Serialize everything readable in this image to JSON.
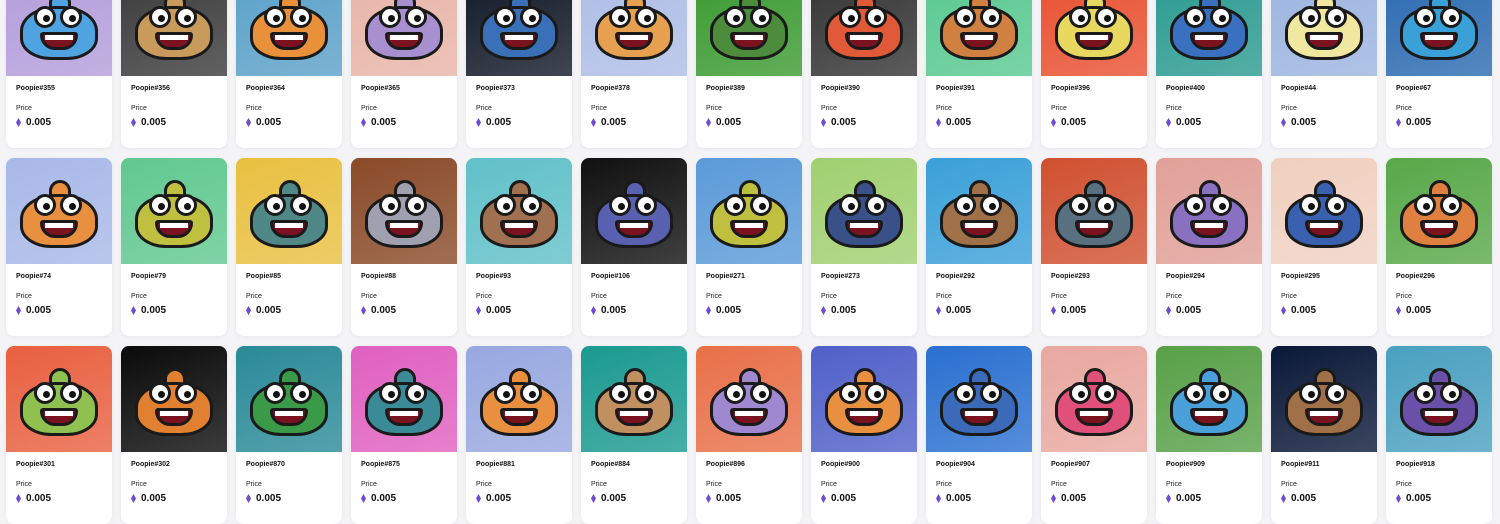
{
  "price_label": "Price",
  "currency_icon": "ethereum-icon",
  "cards": [
    {
      "name": "Poopie#355",
      "price": "0.005",
      "bg": "#b39ddb",
      "body": "#4fa3e0"
    },
    {
      "name": "Poopie#356",
      "price": "0.005",
      "bg": "#3a3a3a",
      "body": "#c89a5c"
    },
    {
      "name": "Poopie#364",
      "price": "0.005",
      "bg": "#5aa0c8",
      "body": "#e8903a"
    },
    {
      "name": "Poopie#365",
      "price": "0.005",
      "bg": "#e8b4a8",
      "body": "#a890d0"
    },
    {
      "name": "Poopie#373",
      "price": "0.005",
      "bg": "#101826",
      "body": "#3a70b8"
    },
    {
      "name": "Poopie#378",
      "price": "0.005",
      "bg": "#aebde6",
      "body": "#e6a050"
    },
    {
      "name": "Poopie#389",
      "price": "0.005",
      "bg": "#3a9a30",
      "body": "#4c8c3c"
    },
    {
      "name": "Poopie#390",
      "price": "0.005",
      "bg": "#333333",
      "body": "#e05a3a"
    },
    {
      "name": "Poopie#391",
      "price": "0.005",
      "bg": "#58c890",
      "body": "#d08040"
    },
    {
      "name": "Poopie#396",
      "price": "0.005",
      "bg": "#e85030",
      "body": "#e8d860"
    },
    {
      "name": "Poopie#400",
      "price": "0.005",
      "bg": "#2a9a90",
      "body": "#3a70c0"
    },
    {
      "name": "Poopie#44",
      "price": "0.005",
      "bg": "#9cb4e0",
      "body": "#f0e8a0"
    },
    {
      "name": "Poopie#67",
      "price": "0.005",
      "bg": "#2a6ab0",
      "body": "#3aa0d8"
    },
    {
      "name": "Poopie#74",
      "price": "0.005",
      "bg": "#a8b8e8",
      "body": "#e89040"
    },
    {
      "name": "Poopie#79",
      "price": "0.005",
      "bg": "#60c890",
      "body": "#c0c040"
    },
    {
      "name": "Poopie#85",
      "price": "0.005",
      "bg": "#e8c040",
      "body": "#508888"
    },
    {
      "name": "Poopie#88",
      "price": "0.005",
      "bg": "#8a4a28",
      "body": "#a0a0b0"
    },
    {
      "name": "Poopie#93",
      "price": "0.005",
      "bg": "#60c0c8",
      "body": "#a07050"
    },
    {
      "name": "Poopie#106",
      "price": "0.005",
      "bg": "#101010",
      "body": "#5a60b0"
    },
    {
      "name": "Poopie#271",
      "price": "0.005",
      "bg": "#5a9ad8",
      "body": "#c0c040"
    },
    {
      "name": "Poopie#273",
      "price": "0.005",
      "bg": "#a0d070",
      "body": "#3a5088"
    },
    {
      "name": "Poopie#292",
      "price": "0.005",
      "bg": "#3aa0d8",
      "body": "#a07048"
    },
    {
      "name": "Poopie#293",
      "price": "0.005",
      "bg": "#d05030",
      "body": "#587080"
    },
    {
      "name": "Poopie#294",
      "price": "0.005",
      "bg": "#e0a098",
      "body": "#8a70c0"
    },
    {
      "name": "Poopie#295",
      "price": "0.005",
      "bg": "#f0d0c0",
      "body": "#3a60b0"
    },
    {
      "name": "Poopie#296",
      "price": "0.005",
      "bg": "#58a848",
      "body": "#e08040"
    },
    {
      "name": "Poopie#301",
      "price": "0.005",
      "bg": "#e86040",
      "body": "#90c050"
    },
    {
      "name": "Poopie#302",
      "price": "0.005",
      "bg": "#0a0a0a",
      "body": "#e08030"
    },
    {
      "name": "Poopie#870",
      "price": "0.005",
      "bg": "#2a8a98",
      "body": "#3a9a48"
    },
    {
      "name": "Poopie#875",
      "price": "0.005",
      "bg": "#e060c0",
      "body": "#3a8a98"
    },
    {
      "name": "Poopie#881",
      "price": "0.005",
      "bg": "#98a8e0",
      "body": "#e89040"
    },
    {
      "name": "Poopie#884",
      "price": "0.005",
      "bg": "#1a9a90",
      "body": "#c09060"
    },
    {
      "name": "Poopie#896",
      "price": "0.005",
      "bg": "#e87048",
      "body": "#a088d0"
    },
    {
      "name": "Poopie#900",
      "price": "0.005",
      "bg": "#5060c8",
      "body": "#e89040"
    },
    {
      "name": "Poopie#904",
      "price": "0.005",
      "bg": "#2a70d0",
      "body": "#3a6ab8"
    },
    {
      "name": "Poopie#907",
      "price": "0.005",
      "bg": "#e8a8a0",
      "body": "#e0507a"
    },
    {
      "name": "Poopie#909",
      "price": "0.005",
      "bg": "#58a048",
      "body": "#4aa0d8"
    },
    {
      "name": "Poopie#911",
      "price": "0.005",
      "bg": "#0a1838",
      "body": "#a07048"
    },
    {
      "name": "Poopie#918",
      "price": "0.005",
      "bg": "#4aa0c0",
      "body": "#6a50a8"
    }
  ]
}
